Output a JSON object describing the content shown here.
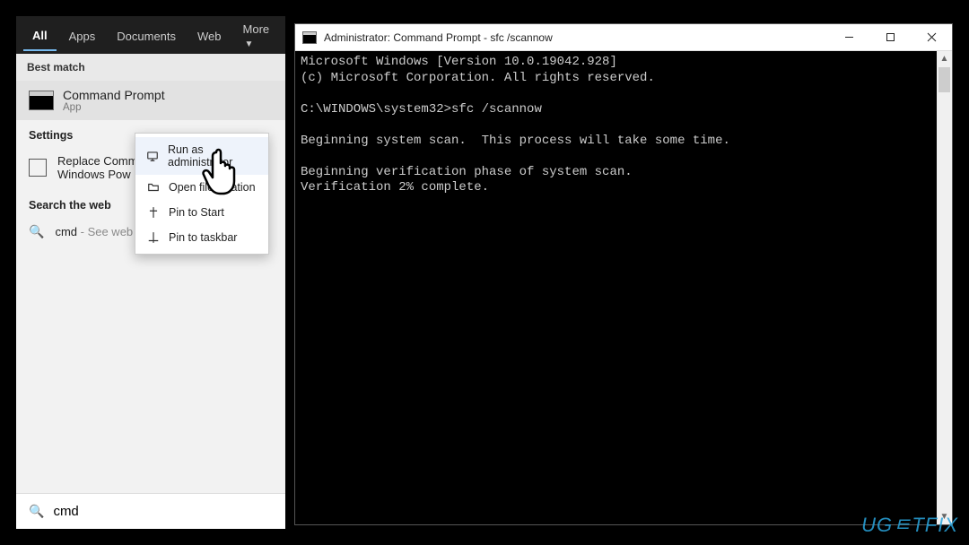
{
  "search": {
    "tabs": [
      "All",
      "Apps",
      "Documents",
      "Web",
      "More"
    ],
    "best_match_header": "Best match",
    "result": {
      "title": "Command Prompt",
      "subtitle": "App"
    },
    "settings_header": "Settings",
    "settings_item": "Replace Command Prompt with Windows PowerShell",
    "settings_item_truncated": "Replace Comm\nWindows Pow",
    "web_header": "Search the web",
    "web_item": {
      "query": "cmd",
      "hint": "- See web results"
    },
    "input_value": "cmd"
  },
  "context_menu": {
    "items": [
      {
        "icon": "admin-icon",
        "label": "Run as administrator"
      },
      {
        "icon": "folder-icon",
        "label": "Open file location"
      },
      {
        "icon": "pin-start-icon",
        "label": "Pin to Start"
      },
      {
        "icon": "pin-taskbar-icon",
        "label": "Pin to taskbar"
      }
    ]
  },
  "cmd": {
    "title": "Administrator: Command Prompt - sfc  /scannow",
    "lines": [
      "Microsoft Windows [Version 10.0.19042.928]",
      "(c) Microsoft Corporation. All rights reserved.",
      "",
      "C:\\WINDOWS\\system32>sfc /scannow",
      "",
      "Beginning system scan.  This process will take some time.",
      "",
      "Beginning verification phase of system scan.",
      "Verification 2% complete."
    ]
  },
  "watermark": "UGㅌTFIX"
}
